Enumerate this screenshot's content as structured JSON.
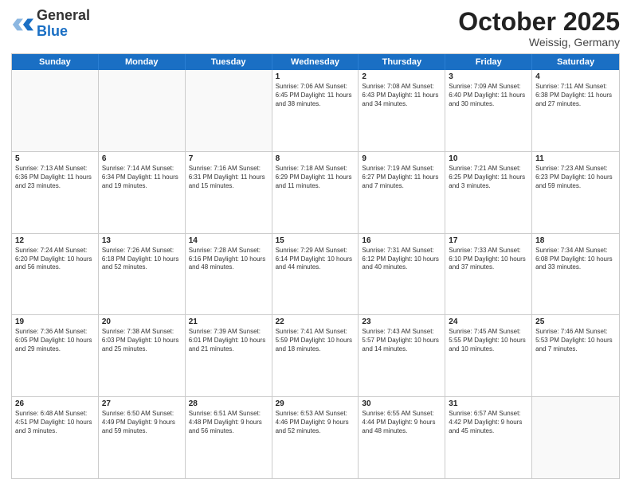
{
  "header": {
    "logo_general": "General",
    "logo_blue": "Blue",
    "month": "October 2025",
    "location": "Weissig, Germany"
  },
  "days_of_week": [
    "Sunday",
    "Monday",
    "Tuesday",
    "Wednesday",
    "Thursday",
    "Friday",
    "Saturday"
  ],
  "weeks": [
    [
      {
        "day": "",
        "text": ""
      },
      {
        "day": "",
        "text": ""
      },
      {
        "day": "",
        "text": ""
      },
      {
        "day": "1",
        "text": "Sunrise: 7:06 AM\nSunset: 6:45 PM\nDaylight: 11 hours and 38 minutes."
      },
      {
        "day": "2",
        "text": "Sunrise: 7:08 AM\nSunset: 6:43 PM\nDaylight: 11 hours and 34 minutes."
      },
      {
        "day": "3",
        "text": "Sunrise: 7:09 AM\nSunset: 6:40 PM\nDaylight: 11 hours and 30 minutes."
      },
      {
        "day": "4",
        "text": "Sunrise: 7:11 AM\nSunset: 6:38 PM\nDaylight: 11 hours and 27 minutes."
      }
    ],
    [
      {
        "day": "5",
        "text": "Sunrise: 7:13 AM\nSunset: 6:36 PM\nDaylight: 11 hours and 23 minutes."
      },
      {
        "day": "6",
        "text": "Sunrise: 7:14 AM\nSunset: 6:34 PM\nDaylight: 11 hours and 19 minutes."
      },
      {
        "day": "7",
        "text": "Sunrise: 7:16 AM\nSunset: 6:31 PM\nDaylight: 11 hours and 15 minutes."
      },
      {
        "day": "8",
        "text": "Sunrise: 7:18 AM\nSunset: 6:29 PM\nDaylight: 11 hours and 11 minutes."
      },
      {
        "day": "9",
        "text": "Sunrise: 7:19 AM\nSunset: 6:27 PM\nDaylight: 11 hours and 7 minutes."
      },
      {
        "day": "10",
        "text": "Sunrise: 7:21 AM\nSunset: 6:25 PM\nDaylight: 11 hours and 3 minutes."
      },
      {
        "day": "11",
        "text": "Sunrise: 7:23 AM\nSunset: 6:23 PM\nDaylight: 10 hours and 59 minutes."
      }
    ],
    [
      {
        "day": "12",
        "text": "Sunrise: 7:24 AM\nSunset: 6:20 PM\nDaylight: 10 hours and 56 minutes."
      },
      {
        "day": "13",
        "text": "Sunrise: 7:26 AM\nSunset: 6:18 PM\nDaylight: 10 hours and 52 minutes."
      },
      {
        "day": "14",
        "text": "Sunrise: 7:28 AM\nSunset: 6:16 PM\nDaylight: 10 hours and 48 minutes."
      },
      {
        "day": "15",
        "text": "Sunrise: 7:29 AM\nSunset: 6:14 PM\nDaylight: 10 hours and 44 minutes."
      },
      {
        "day": "16",
        "text": "Sunrise: 7:31 AM\nSunset: 6:12 PM\nDaylight: 10 hours and 40 minutes."
      },
      {
        "day": "17",
        "text": "Sunrise: 7:33 AM\nSunset: 6:10 PM\nDaylight: 10 hours and 37 minutes."
      },
      {
        "day": "18",
        "text": "Sunrise: 7:34 AM\nSunset: 6:08 PM\nDaylight: 10 hours and 33 minutes."
      }
    ],
    [
      {
        "day": "19",
        "text": "Sunrise: 7:36 AM\nSunset: 6:05 PM\nDaylight: 10 hours and 29 minutes."
      },
      {
        "day": "20",
        "text": "Sunrise: 7:38 AM\nSunset: 6:03 PM\nDaylight: 10 hours and 25 minutes."
      },
      {
        "day": "21",
        "text": "Sunrise: 7:39 AM\nSunset: 6:01 PM\nDaylight: 10 hours and 21 minutes."
      },
      {
        "day": "22",
        "text": "Sunrise: 7:41 AM\nSunset: 5:59 PM\nDaylight: 10 hours and 18 minutes."
      },
      {
        "day": "23",
        "text": "Sunrise: 7:43 AM\nSunset: 5:57 PM\nDaylight: 10 hours and 14 minutes."
      },
      {
        "day": "24",
        "text": "Sunrise: 7:45 AM\nSunset: 5:55 PM\nDaylight: 10 hours and 10 minutes."
      },
      {
        "day": "25",
        "text": "Sunrise: 7:46 AM\nSunset: 5:53 PM\nDaylight: 10 hours and 7 minutes."
      }
    ],
    [
      {
        "day": "26",
        "text": "Sunrise: 6:48 AM\nSunset: 4:51 PM\nDaylight: 10 hours and 3 minutes."
      },
      {
        "day": "27",
        "text": "Sunrise: 6:50 AM\nSunset: 4:49 PM\nDaylight: 9 hours and 59 minutes."
      },
      {
        "day": "28",
        "text": "Sunrise: 6:51 AM\nSunset: 4:48 PM\nDaylight: 9 hours and 56 minutes."
      },
      {
        "day": "29",
        "text": "Sunrise: 6:53 AM\nSunset: 4:46 PM\nDaylight: 9 hours and 52 minutes."
      },
      {
        "day": "30",
        "text": "Sunrise: 6:55 AM\nSunset: 4:44 PM\nDaylight: 9 hours and 48 minutes."
      },
      {
        "day": "31",
        "text": "Sunrise: 6:57 AM\nSunset: 4:42 PM\nDaylight: 9 hours and 45 minutes."
      },
      {
        "day": "",
        "text": ""
      }
    ]
  ]
}
